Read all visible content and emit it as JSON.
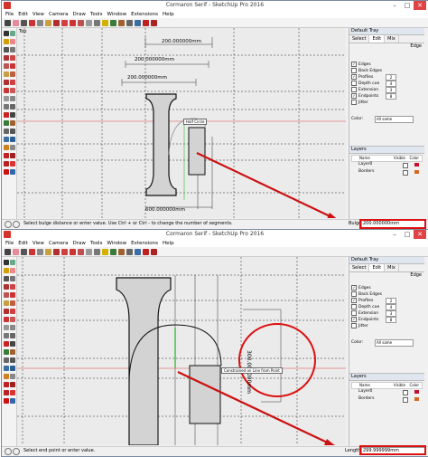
{
  "app": {
    "title": "Cormaron Serif - SketchUp Pro 2016",
    "window_buttons": [
      "–",
      "□",
      "✕"
    ]
  },
  "menu": [
    "File",
    "Edit",
    "View",
    "Camera",
    "Draw",
    "Tools",
    "Window",
    "Extensions",
    "Help"
  ],
  "scene_label": "Top",
  "tray": {
    "title": "Default Tray",
    "tabs": [
      "Select",
      "Edit",
      "Mix"
    ],
    "section": "Edge",
    "options": [
      {
        "label": "Edges",
        "checked": true
      },
      {
        "label": "Back Edges",
        "checked": false
      },
      {
        "label": "Profiles",
        "checked": true,
        "value": "2"
      },
      {
        "label": "Depth cue",
        "checked": false,
        "value": "4"
      },
      {
        "label": "Extension",
        "checked": false,
        "value": "3"
      },
      {
        "label": "Endpoints",
        "checked": true,
        "value": "8"
      },
      {
        "label": "Jitter",
        "checked": false
      }
    ],
    "color_label": "Color:",
    "color_value": "All same"
  },
  "layers": {
    "title": "Layers",
    "columns": [
      "Name",
      "Visible",
      "Color"
    ],
    "rows": [
      {
        "name": "Layer0",
        "color": "#c8102e"
      },
      {
        "name": "Borders",
        "color": "#d2691e"
      }
    ]
  },
  "panel1": {
    "dimensions": [
      "200.000000mm",
      "200.000000mm",
      "200.000000mm",
      "600.000000mm"
    ],
    "tooltip": "Half Circle",
    "status_text": "Select bulge distance or enter value. Use Ctrl + or Ctrl - to change the number of segments.",
    "vcb_label": "Bulge",
    "vcb_value": "200.000000mm"
  },
  "panel2": {
    "dimension": "300.000000mm",
    "tooltip": "Constrained on Line from Point",
    "status_text": "Select end point or enter value.",
    "vcb_label": "Length",
    "vcb_value": "299.999999mm"
  },
  "colors": {
    "accent_red": "#d11111",
    "axis_red": "#e04040",
    "axis_green": "#2eb82e",
    "glyph_fill": "#d3d3d3"
  }
}
